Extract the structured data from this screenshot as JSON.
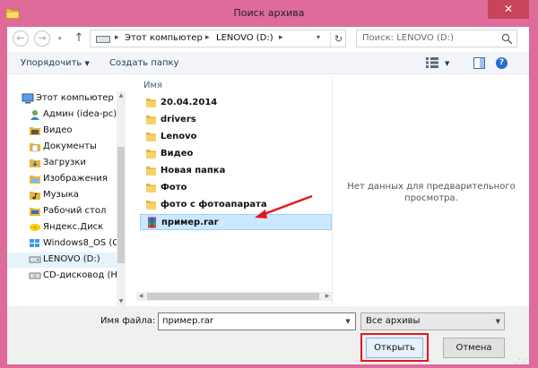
{
  "window": {
    "title": "Поиск архива",
    "close_glyph": "✕"
  },
  "nav": {
    "back_glyph": "←",
    "forward_glyph": "→",
    "dropdown_glyph": "▾",
    "up_glyph": "↑",
    "breadcrumb": [
      "Этот компьютер",
      "LENOVO (D:)"
    ],
    "separator": "▸",
    "refresh_glyph": "↻",
    "search_placeholder": "Поиск: LENOVO (D:)"
  },
  "toolbar": {
    "organize_label": "Упорядочить",
    "organize_caret": "▼",
    "new_folder_label": "Создать папку",
    "view_caret": "▼",
    "help_glyph": "?"
  },
  "sidebar": {
    "items": [
      {
        "label": "Этот компьютер",
        "icon": "computer-icon"
      },
      {
        "label": "Админ (idea-pc)",
        "icon": "user-icon"
      },
      {
        "label": "Видео",
        "icon": "video-folder-icon"
      },
      {
        "label": "Документы",
        "icon": "documents-folder-icon"
      },
      {
        "label": "Загрузки",
        "icon": "downloads-folder-icon"
      },
      {
        "label": "Изображения",
        "icon": "pictures-folder-icon"
      },
      {
        "label": "Музыка",
        "icon": "music-folder-icon"
      },
      {
        "label": "Рабочий стол",
        "icon": "desktop-folder-icon"
      },
      {
        "label": "Яндекс.Диск",
        "icon": "yandex-disk-icon"
      },
      {
        "label": "Windows8_OS (C",
        "icon": "windows-drive-icon"
      },
      {
        "label": "LENOVO (D:)",
        "icon": "drive-icon"
      },
      {
        "label": "CD-дисковод (H",
        "icon": "cd-drive-icon"
      }
    ],
    "selected_index": 10
  },
  "files": {
    "column_name": "Имя",
    "items": [
      {
        "label": "20.04.2014",
        "type": "folder"
      },
      {
        "label": "drivers",
        "type": "folder"
      },
      {
        "label": "Lenovo",
        "type": "folder"
      },
      {
        "label": "Видео",
        "type": "folder"
      },
      {
        "label": "Новая папка",
        "type": "folder"
      },
      {
        "label": "Фото",
        "type": "folder"
      },
      {
        "label": "фото с фотоапарата",
        "type": "folder"
      },
      {
        "label": "пример.rar",
        "type": "rar"
      }
    ],
    "selected_index": 7
  },
  "preview": {
    "message_line1": "Нет данных для предварительного",
    "message_line2": "просмотра."
  },
  "footer": {
    "filename_label": "Имя файла:",
    "filename_value": "пример.rar",
    "filetype_value": "Все архивы",
    "open_label": "Открыть",
    "cancel_label": "Отмена"
  },
  "colors": {
    "frame": "#de6b9a",
    "close": "#c7445b",
    "selection": "#cce8ff",
    "annotation": "#e3161e"
  }
}
